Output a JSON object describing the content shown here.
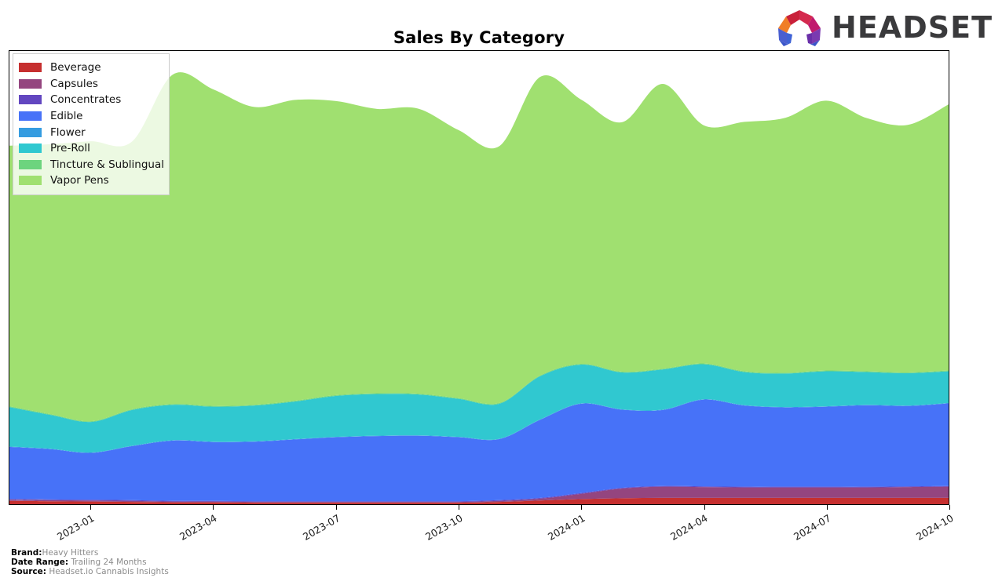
{
  "header": {
    "title": "Sales By Category",
    "logo_text": "HEADSET",
    "logo_icon": "headset-arch-logo"
  },
  "footer": {
    "brand_key": "Brand:",
    "brand_value": "Heavy Hitters",
    "date_range_key": "Date Range:",
    "date_range_value": "Trailing 24 Months",
    "source_key": "Source:",
    "source_value": "Headset.io Cannabis Insights"
  },
  "legend": {
    "position": "upper-left",
    "items": [
      {
        "label": "Beverage",
        "color": "#c62f2f"
      },
      {
        "label": "Capsules",
        "color": "#94457f"
      },
      {
        "label": "Concentrates",
        "color": "#6246c0"
      },
      {
        "label": "Edible",
        "color": "#4772f8"
      },
      {
        "label": "Flower",
        "color": "#359ce0"
      },
      {
        "label": "Pre-Roll",
        "color": "#30c8d0"
      },
      {
        "label": "Tincture & Sublingual",
        "color": "#6dd47e"
      },
      {
        "label": "Vapor Pens",
        "color": "#a0e070"
      }
    ]
  },
  "chart_data": {
    "type": "area",
    "stacked": true,
    "title": "Sales By Category",
    "xlabel": "",
    "ylabel": "",
    "grid": false,
    "x_tick_labels": [
      "2023-01",
      "2023-04",
      "2023-07",
      "2023-10",
      "2024-01",
      "2024-04",
      "2024-07",
      "2024-10"
    ],
    "x": [
      "2022-11",
      "2022-12",
      "2023-01",
      "2023-02",
      "2023-03",
      "2023-04",
      "2023-05",
      "2023-06",
      "2023-07",
      "2023-08",
      "2023-09",
      "2023-10",
      "2023-11",
      "2023-12",
      "2024-01",
      "2024-02",
      "2024-03",
      "2024-04",
      "2024-05",
      "2024-06",
      "2024-07",
      "2024-08",
      "2024-09",
      "2024-10"
    ],
    "series": [
      {
        "name": "Beverage",
        "color": "#c62f2f",
        "values": [
          0.9,
          0.8,
          0.7,
          0.6,
          0.5,
          0.5,
          0.4,
          0.4,
          0.4,
          0.4,
          0.4,
          0.4,
          0.6,
          1.0,
          1.4,
          1.6,
          1.7,
          1.7,
          1.7,
          1.7,
          1.7,
          1.7,
          1.7,
          1.7
        ]
      },
      {
        "name": "Capsules",
        "color": "#94457f",
        "values": [
          0.3,
          0.3,
          0.3,
          0.3,
          0.2,
          0.2,
          0.2,
          0.2,
          0.2,
          0.2,
          0.2,
          0.2,
          0.3,
          0.5,
          1.4,
          2.6,
          3.0,
          2.9,
          2.8,
          2.8,
          2.8,
          2.8,
          2.9,
          3.0
        ]
      },
      {
        "name": "Concentrates",
        "color": "#6246c0",
        "values": [
          0.2,
          0.2,
          0.2,
          0.2,
          0.2,
          0.2,
          0.2,
          0.2,
          0.2,
          0.2,
          0.2,
          0.2,
          0.2,
          0.2,
          0.2,
          0.2,
          0.2,
          0.2,
          0.2,
          0.2,
          0.2,
          0.2,
          0.2,
          0.2
        ]
      },
      {
        "name": "Edible",
        "color": "#4772f8",
        "values": [
          14.0,
          13.5,
          12.6,
          14.5,
          16.2,
          15.8,
          16.0,
          16.6,
          17.2,
          17.5,
          17.6,
          17.2,
          16.4,
          21.0,
          24.0,
          21.0,
          20.4,
          23.3,
          21.8,
          21.3,
          21.5,
          21.9,
          21.6,
          22.2
        ]
      },
      {
        "name": "Flower",
        "color": "#359ce0",
        "values": [
          0.1,
          0.1,
          0.1,
          0.1,
          0.1,
          0.1,
          0.1,
          0.1,
          0.1,
          0.1,
          0.1,
          0.1,
          0.1,
          0.1,
          0.1,
          0.1,
          0.1,
          0.1,
          0.1,
          0.1,
          0.1,
          0.1,
          0.1,
          0.1
        ]
      },
      {
        "name": "Pre-Roll",
        "color": "#30c8d0",
        "values": [
          10.6,
          9.1,
          8.2,
          9.6,
          9.5,
          9.4,
          9.6,
          10.1,
          11.0,
          11.2,
          11.0,
          10.2,
          9.4,
          11.6,
          10.4,
          9.9,
          10.8,
          9.4,
          8.9,
          9.0,
          9.4,
          8.8,
          8.7,
          8.5
        ]
      },
      {
        "name": "Tincture & Sublingual",
        "color": "#6dd47e",
        "values": [
          0.2,
          0.2,
          0.2,
          0.2,
          0.2,
          0.2,
          0.2,
          0.2,
          0.2,
          0.2,
          0.2,
          0.2,
          0.2,
          0.2,
          0.2,
          0.2,
          0.2,
          0.2,
          0.2,
          0.2,
          0.2,
          0.2,
          0.2,
          0.2
        ]
      },
      {
        "name": "Vapor Pens",
        "color": "#a0e070",
        "values": [
          70.0,
          72.5,
          75.2,
          71.9,
          88.5,
          85.0,
          80.0,
          80.8,
          79.0,
          76.4,
          76.6,
          72.0,
          69.0,
          80.2,
          71.0,
          67.0,
          76.5,
          64.0,
          67.0,
          68.5,
          72.5,
          68.0,
          66.5,
          71.5
        ]
      }
    ]
  }
}
